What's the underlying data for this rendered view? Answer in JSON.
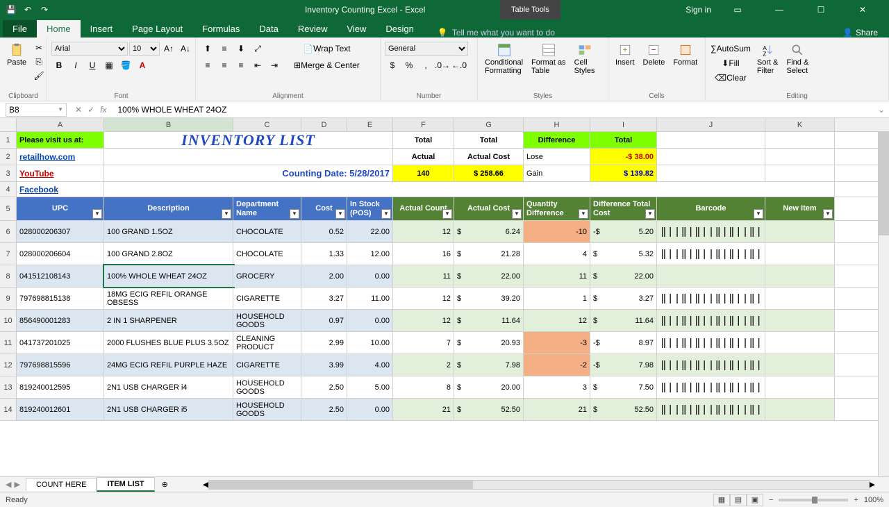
{
  "titlebar": {
    "title": "Inventory Counting Excel - Excel",
    "table_tools": "Table Tools",
    "sign_in": "Sign in"
  },
  "tabs": {
    "file": "File",
    "home": "Home",
    "insert": "Insert",
    "page_layout": "Page Layout",
    "formulas": "Formulas",
    "data": "Data",
    "review": "Review",
    "view": "View",
    "design": "Design",
    "tell_me": "Tell me what you want to do",
    "share": "Share"
  },
  "ribbon": {
    "clipboard": {
      "label": "Clipboard",
      "paste": "Paste"
    },
    "font": {
      "label": "Font",
      "name": "Arial",
      "size": "10"
    },
    "alignment": {
      "label": "Alignment",
      "wrap": "Wrap Text",
      "merge": "Merge & Center"
    },
    "number": {
      "label": "Number",
      "format": "General"
    },
    "styles": {
      "label": "Styles",
      "cf": "Conditional\nFormatting",
      "fat": "Format as\nTable",
      "cs": "Cell\nStyles"
    },
    "cells": {
      "label": "Cells",
      "insert": "Insert",
      "delete": "Delete",
      "format": "Format"
    },
    "editing": {
      "label": "Editing",
      "autosum": "AutoSum",
      "fill": "Fill",
      "clear": "Clear",
      "sort": "Sort &\nFilter",
      "find": "Find &\nSelect"
    }
  },
  "formula_bar": {
    "name_box": "B8",
    "formula": "100% WHOLE WHEAT 24OZ"
  },
  "columns": [
    "A",
    "B",
    "C",
    "D",
    "E",
    "F",
    "G",
    "H",
    "I",
    "J",
    "K"
  ],
  "top_block": {
    "visit": "Please visit us at:",
    "links": [
      "retailhow.com",
      "YouTube",
      "Facebook"
    ],
    "title": "INVENTORY LIST",
    "counting_date_label": "Counting Date:",
    "counting_date": "5/28/2017",
    "totals": {
      "f_hdr1": "Total",
      "f_hdr2": "Actual",
      "f_val": "140",
      "g_hdr1": "Total",
      "g_hdr2": "Actual Cost",
      "g_val": "$   258.66",
      "h_hdr": "Difference",
      "h_lose": "Lose",
      "h_gain": "Gain",
      "i_hdr": "Total",
      "i_lose": "-$    38.00",
      "i_gain": "$   139.82"
    }
  },
  "headers": {
    "upc": "UPC",
    "desc": "Description",
    "dept": "Department Name",
    "cost": "Cost",
    "stock": "In Stock (POS)",
    "acount": "Actual Count",
    "acost": "Actual Cost",
    "qdiff": "Quantity Difference",
    "dtc": "Difference Total Cost",
    "barcode": "Barcode",
    "newitem": "New Item"
  },
  "rows": [
    {
      "n": 6,
      "upc": "028000206307",
      "desc": "100 GRAND 1.5OZ",
      "dept": "CHOCOLATE",
      "cost": "0.52",
      "stock": "22.00",
      "ac": "12",
      "acs": "$",
      "acost": "6.24",
      "qd": "-10",
      "dts": "-$",
      "dtc": "5.20",
      "bc": true,
      "neg": true
    },
    {
      "n": 7,
      "upc": "028000206604",
      "desc": "100 GRAND 2.8OZ",
      "dept": "CHOCOLATE",
      "cost": "1.33",
      "stock": "12.00",
      "ac": "16",
      "acs": "$",
      "acost": "21.28",
      "qd": "4",
      "dts": "$",
      "dtc": "5.32",
      "bc": true
    },
    {
      "n": 8,
      "upc": "041512108143",
      "desc": "100% WHOLE WHEAT 24OZ",
      "dept": "GROCERY",
      "cost": "2.00",
      "stock": "0.00",
      "ac": "11",
      "acs": "$",
      "acost": "22.00",
      "qd": "11",
      "dts": "$",
      "dtc": "22.00",
      "bc": false,
      "sel": true
    },
    {
      "n": 9,
      "upc": "797698815138",
      "desc": "18MG ECIG REFIL ORANGE OBSESS",
      "dept": "CIGARETTE",
      "cost": "3.27",
      "stock": "11.00",
      "ac": "12",
      "acs": "$",
      "acost": "39.20",
      "qd": "1",
      "dts": "$",
      "dtc": "3.27",
      "bc": true
    },
    {
      "n": 10,
      "upc": "856490001283",
      "desc": "2 IN 1 SHARPENER",
      "dept": "HOUSEHOLD GOODS",
      "cost": "0.97",
      "stock": "0.00",
      "ac": "12",
      "acs": "$",
      "acost": "11.64",
      "qd": "12",
      "dts": "$",
      "dtc": "11.64",
      "bc": true
    },
    {
      "n": 11,
      "upc": "041737201025",
      "desc": "2000 FLUSHES BLUE PLUS 3.5OZ",
      "dept": "CLEANING PRODUCT",
      "cost": "2.99",
      "stock": "10.00",
      "ac": "7",
      "acs": "$",
      "acost": "20.93",
      "qd": "-3",
      "dts": "-$",
      "dtc": "8.97",
      "bc": true,
      "neg": true
    },
    {
      "n": 12,
      "upc": "797698815596",
      "desc": "24MG ECIG REFIL PURPLE HAZE",
      "dept": "CIGARETTE",
      "cost": "3.99",
      "stock": "4.00",
      "ac": "2",
      "acs": "$",
      "acost": "7.98",
      "qd": "-2",
      "dts": "-$",
      "dtc": "7.98",
      "bc": true,
      "neg": true
    },
    {
      "n": 13,
      "upc": "819240012595",
      "desc": "2N1 USB CHARGER i4",
      "dept": "HOUSEHOLD GOODS",
      "cost": "2.50",
      "stock": "5.00",
      "ac": "8",
      "acs": "$",
      "acost": "20.00",
      "qd": "3",
      "dts": "$",
      "dtc": "7.50",
      "bc": true
    },
    {
      "n": 14,
      "upc": "819240012601",
      "desc": "2N1 USB CHARGER i5",
      "dept": "HOUSEHOLD GOODS",
      "cost": "2.50",
      "stock": "0.00",
      "ac": "21",
      "acs": "$",
      "acost": "52.50",
      "qd": "21",
      "dts": "$",
      "dtc": "52.50",
      "bc": true
    }
  ],
  "sheet_tabs": {
    "tab1": "COUNT HERE",
    "tab2": "ITEM LIST"
  },
  "status": {
    "ready": "Ready",
    "zoom": "100%"
  }
}
